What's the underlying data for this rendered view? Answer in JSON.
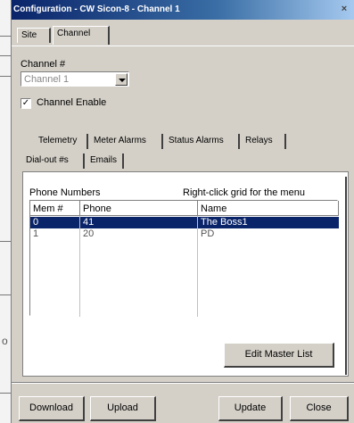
{
  "window": {
    "title": "Configuration - CW Sicon-8 - Channel 1"
  },
  "main_tabs": [
    "Site",
    "Channel"
  ],
  "channel": {
    "label": "Channel #",
    "selected": "Channel 1",
    "enable_label": "Channel Enable",
    "enabled": true
  },
  "sub_tabs": {
    "row1": [
      "Telemetry",
      "Meter Alarms",
      "Status Alarms",
      "Relays"
    ],
    "row2": [
      "Dial-out #s",
      "Emails"
    ],
    "active": "Dial-out #s"
  },
  "phone": {
    "section_label": "Phone Numbers",
    "hint": "Right-click grid for the menu",
    "columns": [
      "Mem #",
      "Phone",
      "Name"
    ],
    "rows": [
      {
        "mem": "0",
        "phone": "41",
        "name": "The Boss1",
        "selected": true
      },
      {
        "mem": "1",
        "phone": "20",
        "name": "PD",
        "selected": false
      }
    ],
    "edit_button": "Edit Master List"
  },
  "footer": {
    "download": "Download",
    "upload": "Upload",
    "update": "Update",
    "close": "Close"
  },
  "background": {
    "edge_mark": "o"
  },
  "colors": {
    "dialog": "#d4d0c8",
    "titlebar": "#0a246a",
    "selection": "#0a246a"
  }
}
